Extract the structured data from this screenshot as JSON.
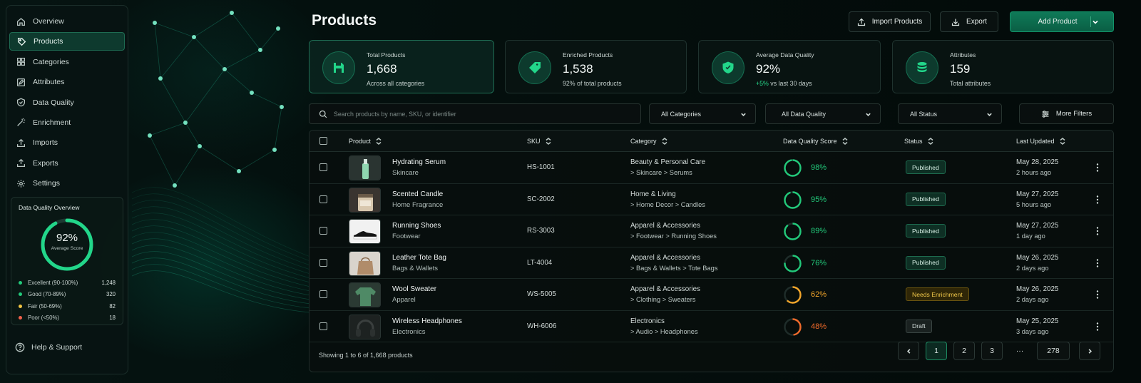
{
  "sidebar": {
    "items": [
      {
        "label": "Overview"
      },
      {
        "label": "Products"
      },
      {
        "label": "Categories"
      },
      {
        "label": "Attributes"
      },
      {
        "label": "Data Quality"
      },
      {
        "label": "Enrichment"
      },
      {
        "label": "Imports"
      },
      {
        "label": "Exports"
      },
      {
        "label": "Settings"
      }
    ],
    "active": "Products",
    "dq_overview": {
      "title": "Data Quality Overview",
      "score": "92%",
      "score_value": 92,
      "score_label": "Average Score",
      "rows": [
        {
          "label": "Excellent (90-100%)",
          "count": "1,248",
          "color": "#22c97a"
        },
        {
          "label": "Good (70-89%)",
          "count": "320",
          "color": "#22c97a"
        },
        {
          "label": "Fair (50-69%)",
          "count": "82",
          "color": "#f2c443"
        },
        {
          "label": "Poor (<50%)",
          "count": "18",
          "color": "#f0604a"
        }
      ]
    },
    "help": "Help & Support"
  },
  "header": {
    "title": "Products",
    "import_label": "Import Products",
    "export_label": "Export",
    "add_label": "Add Product"
  },
  "stats": [
    {
      "label": "Total Products",
      "value": "1,668",
      "sub": "Across all categories"
    },
    {
      "label": "Enriched Products",
      "value": "1,538",
      "sub": "92% of total products"
    },
    {
      "label": "Average Data Quality",
      "value": "92%",
      "sub_up": "+5%",
      "sub": " vs last 30 days"
    },
    {
      "label": "Attributes",
      "value": "159",
      "sub": "Total attributes"
    }
  ],
  "filters": {
    "search_placeholder": "Search products by name, SKU, or identifier",
    "category": "All Categories",
    "data_quality": "All Data Quality",
    "status": "All Status",
    "more": "More Filters"
  },
  "table": {
    "columns": [
      "Product",
      "SKU",
      "Category",
      "Data Quality Score",
      "Status",
      "Last Updated"
    ],
    "rows": [
      {
        "name": "Hydrating Serum",
        "subcat": "Skincare",
        "sku": "HS-1001",
        "cat1": "Beauty & Personal Care",
        "cat2": "> Skincare > Serums",
        "score": "98%",
        "score_value": 98,
        "score_color": "#22c97a",
        "status": "Published",
        "status_type": "pub",
        "date": "May 28, 2025",
        "ago": "2 hours ago"
      },
      {
        "name": "Scented Candle",
        "subcat": "Home Fragrance",
        "sku": "SC-2002",
        "cat1": "Home & Living",
        "cat2": "> Home Decor > Candles",
        "score": "95%",
        "score_value": 95,
        "score_color": "#22c97a",
        "status": "Published",
        "status_type": "pub",
        "date": "May 27, 2025",
        "ago": "5 hours ago"
      },
      {
        "name": "Running Shoes",
        "subcat": "Footwear",
        "sku": "RS-3003",
        "cat1": "Apparel & Accessories",
        "cat2": "> Footwear > Running Shoes",
        "score": "89%",
        "score_value": 89,
        "score_color": "#22c97a",
        "status": "Published",
        "status_type": "pub",
        "date": "May 27, 2025",
        "ago": "1 day ago"
      },
      {
        "name": "Leather Tote Bag",
        "subcat": "Bags & Wallets",
        "sku": "LT-4004",
        "cat1": "Apparel & Accessories",
        "cat2": "> Bags & Wallets > Tote Bags",
        "score": "76%",
        "score_value": 76,
        "score_color": "#22c97a",
        "status": "Published",
        "status_type": "pub",
        "date": "May 26, 2025",
        "ago": "2 days ago"
      },
      {
        "name": "Wool Sweater",
        "subcat": "Apparel",
        "sku": "WS-5005",
        "cat1": "Apparel & Accessories",
        "cat2": "> Clothing > Sweaters",
        "score": "62%",
        "score_value": 62,
        "score_color": "#f2a52a",
        "status": "Needs Enrichment",
        "status_type": "need",
        "date": "May 26, 2025",
        "ago": "2 days ago"
      },
      {
        "name": "Wireless Headphones",
        "subcat": "Electronics",
        "sku": "WH-6006",
        "cat1": "Electronics",
        "cat2": "> Audio > Headphones",
        "score": "48%",
        "score_value": 48,
        "score_color": "#f06a2a",
        "status": "Draft",
        "status_type": "draft",
        "date": "May 25, 2025",
        "ago": "3 days ago"
      }
    ],
    "footer": "Showing 1 to 6 of 1,668 products",
    "pages": [
      "1",
      "2",
      "3",
      "···",
      "278"
    ]
  },
  "colors": {
    "accent": "#22d68a",
    "brand": "#0f7a58"
  }
}
